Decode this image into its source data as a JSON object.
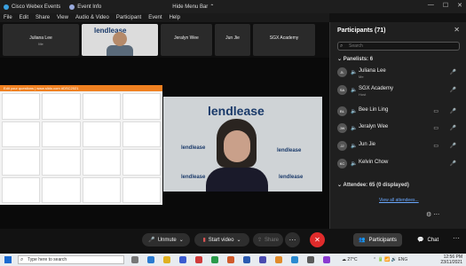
{
  "titlebar": {
    "app": "Cisco Webex Events",
    "event_info": "Event Info",
    "hide_menu": "Hide Menu Bar"
  },
  "menu": [
    "File",
    "Edit",
    "Share",
    "View",
    "Audio & Video",
    "Participant",
    "Event",
    "Help"
  ],
  "tiles": [
    {
      "name": "Juliana Lee",
      "sub": "Me"
    },
    {
      "name": "",
      "sub": "",
      "video": true,
      "logo": "lendlease"
    },
    {
      "name": "Jeralyn Wee",
      "sub": ""
    },
    {
      "name": "Jun Jie",
      "sub": ""
    },
    {
      "name": "SGX Academy",
      "sub": ""
    }
  ],
  "presentation": {
    "header": "Edit your questions | www.slido.com #DSC2021",
    "logos": [
      "lendlease",
      "lendlease",
      "lendlease",
      "lendlease",
      "lendlease"
    ]
  },
  "controls": {
    "unmute": "Unmute",
    "start_video": "Start video",
    "share": "Share",
    "more": "···",
    "leave": "✕",
    "participants": "Participants",
    "chat": "Chat"
  },
  "panel": {
    "title": "Participants (71)",
    "search_placeholder": "Search",
    "panelists_label": "Panelists: 6",
    "attendee_label": "Attendee: 65 (0 displayed)",
    "view_all": "View all attendees...",
    "participants": [
      {
        "initials": "JL",
        "name": "Juliana Lee",
        "role": "Me",
        "camera": false,
        "muted": true
      },
      {
        "initials": "SA",
        "name": "SGX Academy",
        "role": "Host",
        "camera": false,
        "muted": true
      },
      {
        "initials": "BL",
        "name": "Bee Lin Ling",
        "role": "",
        "camera": true,
        "muted": true
      },
      {
        "initials": "JW",
        "name": "Jeralyn Wee",
        "role": "",
        "camera": true,
        "muted": true
      },
      {
        "initials": "JJ",
        "name": "Jun Jie",
        "role": "",
        "camera": true,
        "muted": true
      },
      {
        "initials": "KC",
        "name": "Kelvin Chow",
        "role": "",
        "camera": false,
        "muted": true
      }
    ]
  },
  "taskbar": {
    "search": "Type here to search",
    "weather": "27°C",
    "time": "12:56 PM",
    "date": "23/11/2021",
    "lang": "ENG"
  }
}
